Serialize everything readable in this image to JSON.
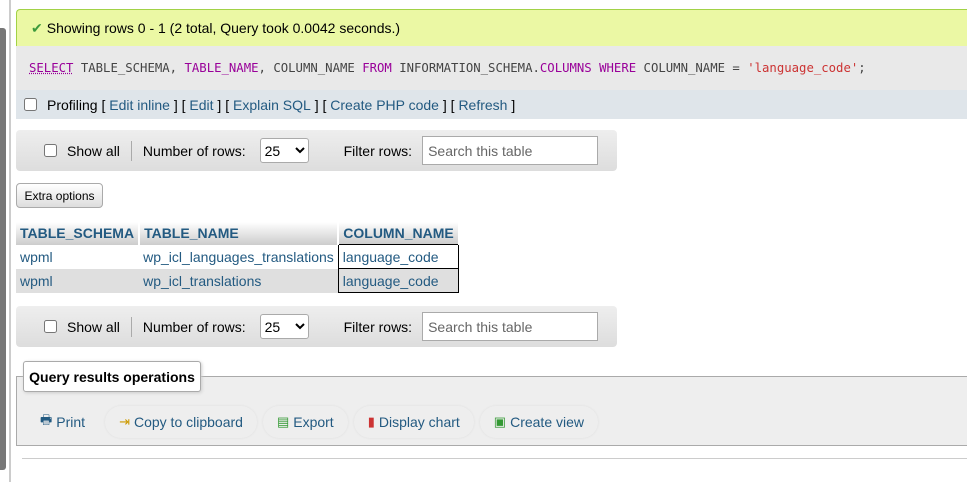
{
  "message": "Showing rows 0 - 1 (2 total, Query took 0.0042 seconds.)",
  "sql": {
    "select": "SELECT",
    "p1": " TABLE_SCHEMA, ",
    "table_name": "TABLE_NAME",
    "p2": ", COLUMN_NAME ",
    "from": "FROM",
    "p3": " INFORMATION_SCHEMA.",
    "columns": "COLUMNS",
    "p4": " ",
    "where": "WHERE",
    "p5": " COLUMN_NAME = ",
    "str": "'language_code'",
    "p6": ";"
  },
  "profiling": {
    "label": "Profiling",
    "links": [
      "Edit inline",
      "Edit",
      "Explain SQL",
      "Create PHP code",
      "Refresh"
    ]
  },
  "nav": {
    "show_all": "Show all",
    "rows_label": "Number of rows:",
    "rows_value": "25",
    "filter_label": "Filter rows:",
    "filter_placeholder": "Search this table"
  },
  "extra_options": "Extra options",
  "table": {
    "headers": [
      "TABLE_SCHEMA",
      "TABLE_NAME",
      "COLUMN_NAME"
    ],
    "rows": [
      [
        "wpml",
        "wp_icl_languages_translations",
        "language_code"
      ],
      [
        "wpml",
        "wp_icl_translations",
        "language_code"
      ]
    ]
  },
  "operations": {
    "title": "Query results operations",
    "items": [
      "Print",
      "Copy to clipboard",
      "Export",
      "Display chart",
      "Create view"
    ]
  }
}
